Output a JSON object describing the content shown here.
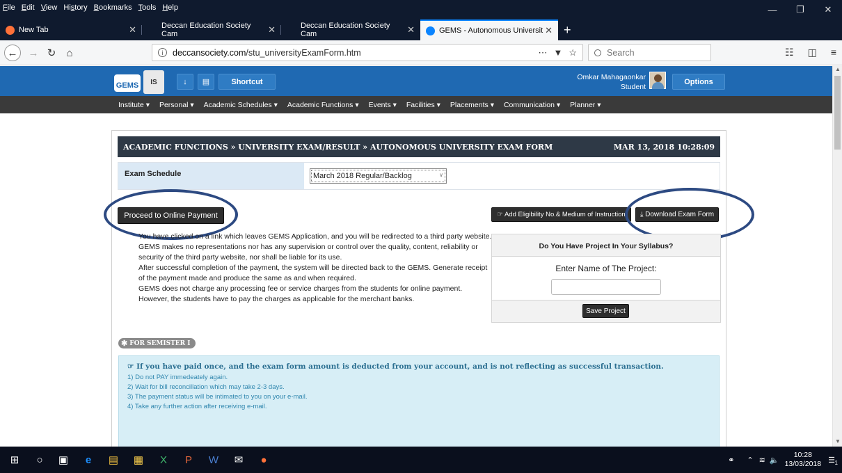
{
  "menubar": {
    "items": [
      {
        "u": "F",
        "rest": "ile"
      },
      {
        "u": "E",
        "rest": "dit"
      },
      {
        "u": "V",
        "rest": "iew"
      },
      {
        "u": "",
        "rest": "Hi",
        "u2": "s",
        "rest2": "tory"
      },
      {
        "u": "B",
        "rest": "ookmarks"
      },
      {
        "u": "T",
        "rest": "ools"
      },
      {
        "u": "H",
        "rest": "elp"
      }
    ]
  },
  "tabs": [
    {
      "title": "New Tab",
      "favicon_color": "#ff7139"
    },
    {
      "title": "Deccan Education Society Cam",
      "favicon_color": ""
    },
    {
      "title": "Deccan Education Society Cam",
      "favicon_color": ""
    },
    {
      "title": "GEMS - Autonomous Universit",
      "favicon_color": "#0a84ff",
      "active": true
    }
  ],
  "navbar": {
    "url_domain": "deccansociety.com",
    "url_path": "/stu_universityExamForm.htm",
    "search_placeholder": "Search"
  },
  "gems": {
    "logo_text": "GEMS",
    "crest_text": "IS",
    "shortcut_label": "Shortcut",
    "user_name": "Omkar Mahagaonkar",
    "user_role": "Student",
    "options_label": "Options",
    "nav_items": [
      "Institute ▾",
      "Personal ▾",
      "Academic Schedules ▾",
      "Academic Functions ▾",
      "Events ▾",
      "Facilities ▾",
      "Placements ▾",
      "Communication ▾",
      "Planner ▾"
    ]
  },
  "page": {
    "breadcrumb": "ACADEMIC FUNCTIONS » UNIVERSITY EXAM/RESULT » AUTONOMOUS UNIVERSITY EXAM FORM",
    "datetime": "MAR 13, 2018 10:28:09",
    "exam_schedule_label": "Exam Schedule",
    "exam_schedule_value": "March 2018 Regular/Backlog",
    "proceed_label": "Proceed to Online Payment",
    "eligibility_label": "☞ Add Eligibility No.& Medium of Instruction",
    "download_label": "⤓ Download Exam Form",
    "disclaimer": [
      "You have clicked on a link which leaves GEMS Application, and you will be redirected to a third party website. GEMS makes no representations nor has any supervision or control over the quality, content, reliability or security of the third party website, nor shall be liable for its use.",
      "After successful completion of the payment, the system will be directed back to the GEMS. Generate receipt of the payment made and produce the same as and when required.",
      "GEMS does not charge any processing fee or service charges from the students for online payment. However, the students have to pay the charges as applicable for the merchant banks."
    ],
    "project_heading": "Do You Have Project In Your Syllabus?",
    "project_label": "Enter Name of The Project:",
    "project_value": "",
    "save_project_label": "Save Project",
    "semester_badge": "FOR SEMISTER I",
    "notice_heading": "☞ If you have paid once, and the exam form amount is deducted from your account, and is not reflecting as successful transaction.",
    "notice_lines": [
      "1) Do not PAY immedeately again.",
      "2) Wait for bill reconcillation which may take 2-3 days.",
      "3) The payment status will be intimated to you on your e-mail.",
      "4) Take any further action after receiving e-mail."
    ]
  },
  "taskbar": {
    "time": "10:28",
    "date": "13/03/2018",
    "notification_count": "1"
  },
  "colors": {
    "gems_blue": "#1f69b2",
    "title_bar": "#2e3946",
    "annotation_circle": "#2d4a82",
    "notice_bg": "#d7eef6"
  }
}
